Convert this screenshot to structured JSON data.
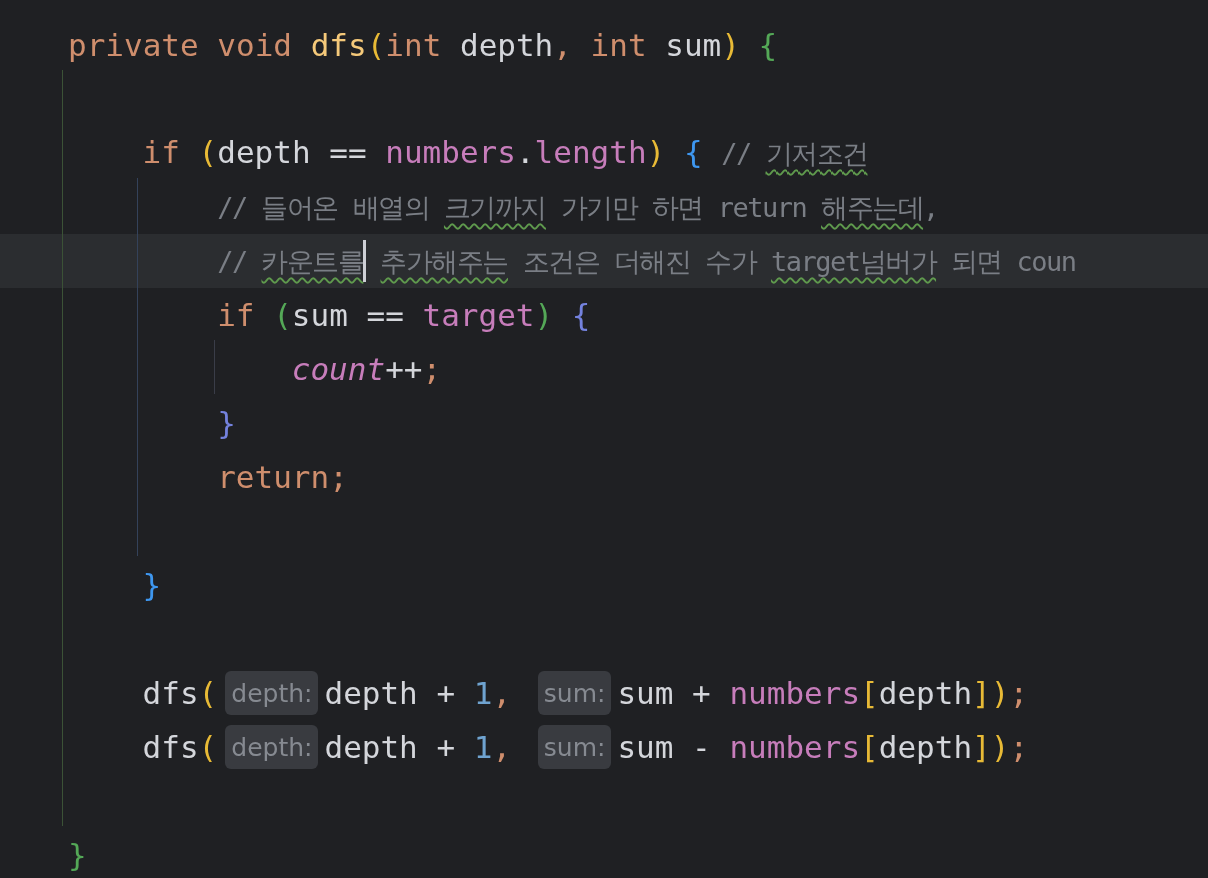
{
  "editor": {
    "lines": [
      {
        "kind": "code",
        "current": false,
        "tokens": [
          {
            "kind": "keyword",
            "text": "private void "
          },
          {
            "kind": "declaration",
            "text": "dfs"
          },
          {
            "kind": "paren-yellow",
            "text": "("
          },
          {
            "kind": "keyword",
            "text": "int "
          },
          {
            "kind": "plain",
            "text": "depth"
          },
          {
            "kind": "keyword",
            "text": ", int "
          },
          {
            "kind": "plain",
            "text": "sum"
          },
          {
            "kind": "paren-yellow",
            "text": ") "
          },
          {
            "kind": "brace-green",
            "text": "{"
          }
        ],
        "children": [
          {
            "kind": "blank"
          },
          {
            "kind": "code",
            "current": false,
            "tokens": [
              {
                "kind": "keyword",
                "text": "if "
              },
              {
                "kind": "paren-yellow",
                "text": "("
              },
              {
                "kind": "plain",
                "text": "depth == "
              },
              {
                "kind": "field",
                "text": "numbers"
              },
              {
                "kind": "plain",
                "text": "."
              },
              {
                "kind": "field",
                "text": "length"
              },
              {
                "kind": "paren-yellow",
                "text": ") "
              },
              {
                "kind": "brace-blue",
                "text": "{ "
              },
              {
                "kind": "comment",
                "parts": [
                  {
                    "text": "// ",
                    "misspelled": false
                  },
                  {
                    "text": "기저조건",
                    "misspelled": true
                  }
                ]
              }
            ],
            "children": [
              {
                "kind": "code",
                "current": false,
                "tokens": [
                  {
                    "kind": "comment",
                    "parts": [
                      {
                        "text": "// 들어온 배열의 ",
                        "misspelled": false
                      },
                      {
                        "text": "크기까지",
                        "misspelled": true
                      },
                      {
                        "text": " 가기만 하면 return ",
                        "misspelled": false
                      },
                      {
                        "text": "해주는데",
                        "misspelled": true
                      },
                      {
                        "text": ",",
                        "misspelled": false
                      }
                    ]
                  }
                ]
              },
              {
                "kind": "code",
                "current": true,
                "tokens": [
                  {
                    "kind": "comment",
                    "parts": [
                      {
                        "text": "// ",
                        "misspelled": false
                      },
                      {
                        "text": "카운트를",
                        "misspelled": true
                      }
                    ]
                  },
                  {
                    "kind": "caret"
                  },
                  {
                    "kind": "comment",
                    "parts": [
                      {
                        "text": "추가해주는",
                        "misspelled": true,
                        "spaced": true
                      },
                      {
                        "text": " 조건은 더해진 수가 ",
                        "misspelled": false
                      },
                      {
                        "text": "target넘버가",
                        "misspelled": true
                      },
                      {
                        "text": " 되면 coun",
                        "misspelled": false
                      }
                    ]
                  }
                ]
              },
              {
                "kind": "code",
                "current": false,
                "tokens": [
                  {
                    "kind": "keyword",
                    "text": "if "
                  },
                  {
                    "kind": "paren-green",
                    "text": "("
                  },
                  {
                    "kind": "plain",
                    "text": "sum == "
                  },
                  {
                    "kind": "field",
                    "text": "target"
                  },
                  {
                    "kind": "paren-green",
                    "text": ") "
                  },
                  {
                    "kind": "brace-violet",
                    "text": "{"
                  }
                ],
                "children": [
                  {
                    "kind": "code",
                    "current": false,
                    "tokens": [
                      {
                        "kind": "static-field",
                        "text": "count"
                      },
                      {
                        "kind": "plain",
                        "text": "++"
                      },
                      {
                        "kind": "keyword",
                        "text": ";"
                      }
                    ]
                  }
                ]
              },
              {
                "kind": "code",
                "current": false,
                "tokens": [
                  {
                    "kind": "brace-violet",
                    "text": "}"
                  }
                ]
              },
              {
                "kind": "code",
                "current": false,
                "tokens": [
                  {
                    "kind": "keyword",
                    "text": "return;"
                  }
                ]
              },
              {
                "kind": "blank"
              }
            ]
          },
          {
            "kind": "code",
            "current": false,
            "tokens": [
              {
                "kind": "brace-blue",
                "text": "}"
              }
            ]
          },
          {
            "kind": "blank"
          },
          {
            "kind": "code",
            "current": false,
            "tokens": [
              {
                "kind": "plain",
                "text": "dfs"
              },
              {
                "kind": "paren-yellow",
                "text": "("
              },
              {
                "kind": "hint",
                "text": "depth:"
              },
              {
                "kind": "plain",
                "text": "depth + "
              },
              {
                "kind": "number",
                "text": "1"
              },
              {
                "kind": "keyword",
                "text": ", "
              },
              {
                "kind": "hint",
                "text": "sum:"
              },
              {
                "kind": "plain",
                "text": "sum + "
              },
              {
                "kind": "field",
                "text": "numbers"
              },
              {
                "kind": "paren-yellow",
                "text": "["
              },
              {
                "kind": "plain",
                "text": "depth"
              },
              {
                "kind": "paren-yellow",
                "text": "])"
              },
              {
                "kind": "keyword",
                "text": ";"
              }
            ]
          },
          {
            "kind": "code",
            "current": false,
            "tokens": [
              {
                "kind": "plain",
                "text": "dfs"
              },
              {
                "kind": "paren-yellow",
                "text": "("
              },
              {
                "kind": "hint",
                "text": "depth:"
              },
              {
                "kind": "plain",
                "text": "depth + "
              },
              {
                "kind": "number",
                "text": "1"
              },
              {
                "kind": "keyword",
                "text": ", "
              },
              {
                "kind": "hint",
                "text": "sum:"
              },
              {
                "kind": "plain",
                "text": "sum - "
              },
              {
                "kind": "field",
                "text": "numbers"
              },
              {
                "kind": "paren-yellow",
                "text": "["
              },
              {
                "kind": "plain",
                "text": "depth"
              },
              {
                "kind": "paren-yellow",
                "text": "])"
              },
              {
                "kind": "keyword",
                "text": ";"
              }
            ]
          },
          {
            "kind": "blank"
          }
        ]
      },
      {
        "kind": "code",
        "current": false,
        "tokens": [
          {
            "kind": "brace-green",
            "text": "}"
          }
        ]
      }
    ]
  }
}
